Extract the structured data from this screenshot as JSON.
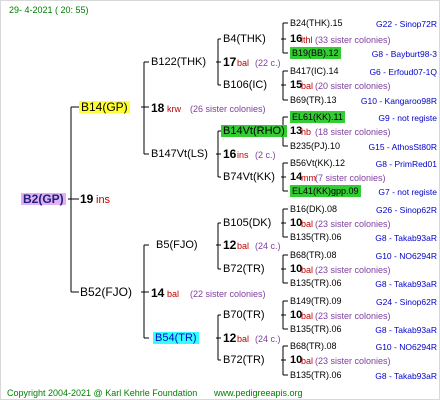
{
  "header": {
    "date": "29-   4-2021  (  20:  55)"
  },
  "root": {
    "name": "B2(GP)",
    "year": "19",
    "breeder": "ins"
  },
  "gen2": [
    {
      "name": "B14(GP)",
      "year": "18",
      "breeder": "krw",
      "sisters": "(26 sister colonies)"
    },
    {
      "name": "B52(FJO)",
      "year": "14",
      "breeder": "bal",
      "sisters": "(22 sister colonies)"
    }
  ],
  "gen3": [
    {
      "name": "B122(THK)",
      "year": "17",
      "breeder": "bal",
      "sisters": "(22 c.)"
    },
    {
      "name": "B147Vt(LS)",
      "year": "16",
      "breeder": "ins",
      "sisters": "(2 c.)"
    },
    {
      "name": "B5(FJO)",
      "year": "12",
      "breeder": "bal",
      "sisters": "(24 c.)"
    },
    {
      "name": "B54(TR)",
      "year": "12",
      "breeder": "bal",
      "sisters": "(24 c.)"
    }
  ],
  "gen4": [
    {
      "name": "B4(THK)",
      "year": "16",
      "breeder": "lthl",
      "sisters": "(33 sister colonies)"
    },
    {
      "name": "B106(IC)",
      "year": "15",
      "breeder": "bal",
      "sisters": "(20 sister colonies)"
    },
    {
      "name": "B14Vt(RHO)",
      "year": "13",
      "breeder": "hb",
      "sisters": "(18 sister colonies)"
    },
    {
      "name": "B74Vt(KK)",
      "year": "14",
      "breeder": "mm",
      "sisters": "(7 sister colonies)"
    },
    {
      "name": "B105(DK)",
      "year": "10",
      "breeder": "bal",
      "sisters": "(23 sister colonies)"
    },
    {
      "name": "B72(TR)",
      "year": "10",
      "breeder": "bal",
      "sisters": "(23 sister colonies)"
    },
    {
      "name": "B70(TR)",
      "year": "10",
      "breeder": "bal",
      "sisters": "(23 sister colonies)"
    },
    {
      "name": "B72(TR)",
      "year": "10",
      "breeder": "bal",
      "sisters": "(23 sister colonies)"
    }
  ],
  "gen5": [
    {
      "name": "B24(THK).15",
      "id": "G22 - Sinop72R",
      "hl": ""
    },
    {
      "name": "B19(BB).12",
      "id": "G8 - Bayburt98-3",
      "hl": "green"
    },
    {
      "name": "B417(IC).14",
      "id": "G6 - Erfoud07-1Q",
      "hl": ""
    },
    {
      "name": "B69(TR).13",
      "id": "G10 - Kangaroo98R",
      "hl": ""
    },
    {
      "name": "EL61(KK).11",
      "id": "G9 - not registe",
      "hl": "green"
    },
    {
      "name": "B235(PJ).10",
      "id": "G15 - AthosSt80R",
      "hl": ""
    },
    {
      "name": "B56Vt(KK).12",
      "id": "G8 - PrimRed01",
      "hl": ""
    },
    {
      "name": "EL41(KK)gpp.09",
      "id": "G7 - not registe",
      "hl": "green"
    },
    {
      "name": "B16(DK).08",
      "id": "G26 - Sinop62R",
      "hl": ""
    },
    {
      "name": "B135(TR).06",
      "id": "G8 - Takab93aR",
      "hl": ""
    },
    {
      "name": "B68(TR).08",
      "id": "G10 - NO6294R",
      "hl": ""
    },
    {
      "name": "B135(TR).06",
      "id": "G8 - Takab93aR",
      "hl": ""
    },
    {
      "name": "B149(TR).09",
      "id": "G24 - Sinop62R",
      "hl": ""
    },
    {
      "name": "B135(TR).06",
      "id": "G8 - Takab93aR",
      "hl": ""
    },
    {
      "name": "B68(TR).08",
      "id": "G10 - NO6294R",
      "hl": ""
    },
    {
      "name": "B135(TR).06",
      "id": "G8 - Takab93aR",
      "hl": ""
    }
  ],
  "footer": {
    "copyright": "Copyright 2004-2021 @ Karl Kehrle Foundation",
    "website": "www.pedigreeapis.org"
  }
}
